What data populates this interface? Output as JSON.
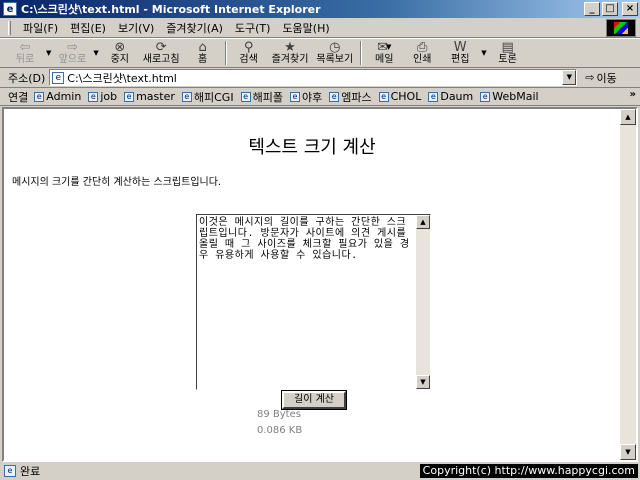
{
  "window": {
    "title": "C:\\스크린샷\\text.html - Microsoft Internet Explorer",
    "controls": {
      "minimize": "_",
      "maximize": "□",
      "close": "×"
    }
  },
  "menu": [
    "파일(F)",
    "편집(E)",
    "보기(V)",
    "즐겨찾기(A)",
    "도구(T)",
    "도움말(H)"
  ],
  "toolbar": {
    "back": "뒤로",
    "forward": "앞으로",
    "stop": "중지",
    "refresh": "새로고침",
    "home": "홈",
    "search": "검색",
    "favorites": "즐겨찾기",
    "history": "목록보기",
    "mail": "메일",
    "print": "인쇄",
    "edit": "편집",
    "discuss": "토론"
  },
  "address": {
    "label": "주소(D)",
    "value": "C:\\스크린샷\\text.html",
    "go": "이동"
  },
  "links": {
    "label": "연결",
    "items": [
      "Admin",
      "job",
      "master",
      "해피CGI",
      "해피폴",
      "야후",
      "엠파스",
      "CHOL",
      "Daum",
      "WebMail"
    ]
  },
  "page": {
    "title": "텍스트 크기 계산",
    "description": "메시지의 크기를 간단히 계산하는 스크립트입니다.",
    "textarea_value": "이것은 메시지의 길이를 구하는 간단한 스크립트입니다. 방문자가 사이트에 의견 게시를 올릴 때 그 사이즈를 체크할 필요가 있을 경우 유용하게 사용할 수 있습니다.",
    "button_label": "길이 계산",
    "result_bytes": "89 Bytes",
    "result_kb": "0.086 KB"
  },
  "status": {
    "text": "완료",
    "copyright": "Copyright(c) http://www.happycgi.com"
  }
}
